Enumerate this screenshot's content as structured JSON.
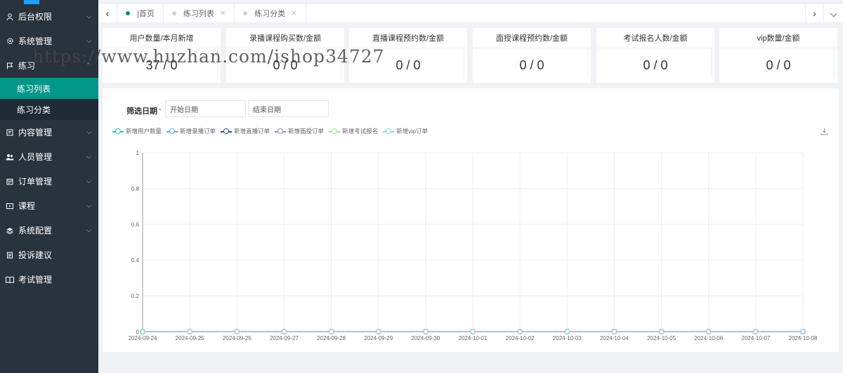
{
  "sidebar": {
    "items": [
      {
        "label": "后台权限",
        "icon": "user-icon",
        "arrow": "down"
      },
      {
        "label": "系统管理",
        "icon": "gear-icon",
        "arrow": "down"
      },
      {
        "label": "练习",
        "icon": "flag-icon",
        "arrow": "up"
      },
      {
        "label": "内容管理",
        "icon": "doc-icon",
        "arrow": "down"
      },
      {
        "label": "人员管理",
        "icon": "users-icon",
        "arrow": "down"
      },
      {
        "label": "订单管理",
        "icon": "calendar-icon",
        "arrow": "down"
      },
      {
        "label": "课程",
        "icon": "play-icon",
        "arrow": "down"
      },
      {
        "label": "系统配置",
        "icon": "layers-icon",
        "arrow": "down"
      },
      {
        "label": "投诉建议",
        "icon": "note-icon",
        "arrow": ""
      },
      {
        "label": "考试管理",
        "icon": "book-icon",
        "arrow": ""
      }
    ],
    "sub_items": [
      {
        "label": "练习列表",
        "active": true
      },
      {
        "label": "练习分类",
        "active": false
      }
    ]
  },
  "tabs": [
    {
      "label": "|首页",
      "closable": false
    },
    {
      "label": "练习列表",
      "closable": true
    },
    {
      "label": "练习分类",
      "closable": true
    }
  ],
  "stats": [
    {
      "title": "用户数量/本月新增",
      "value": "37 / 0"
    },
    {
      "title": "录播课程购买数/金额",
      "value": "0 / 0"
    },
    {
      "title": "直播课程预约数/金额",
      "value": "0 / 0"
    },
    {
      "title": "面授课程预约数/金额",
      "value": "0 / 0"
    },
    {
      "title": "考试报名人数/金额",
      "value": "0 / 0"
    },
    {
      "title": "vip数量/金额",
      "value": "0 / 0"
    }
  ],
  "watermark": "https://www.huzhan.com/ishop34727",
  "filter": {
    "label": "筛选日期",
    "dash": "-",
    "start_placeholder": "开始日期",
    "end_placeholder": "结束日期"
  },
  "colors": {
    "accent": "#009688",
    "sidebar_bg": "#28333e"
  },
  "chart_data": {
    "type": "line",
    "x": [
      "2024-09-24",
      "2024-09-25",
      "2024-09-26",
      "2024-09-27",
      "2024-09-28",
      "2024-09-29",
      "2024-09-30",
      "2024-10-01",
      "2024-10-02",
      "2024-10-03",
      "2024-10-04",
      "2024-10-05",
      "2024-10-06",
      "2024-10-07",
      "2024-10-08"
    ],
    "yticks": [
      "0",
      "0.2",
      "0.4",
      "0.6",
      "0.8",
      "1"
    ],
    "ylim": [
      0,
      1
    ],
    "grid": true,
    "legend_position": "top-left",
    "series": [
      {
        "name": "新增用户数量",
        "color": "#2ec7c9",
        "values": [
          0,
          0,
          0,
          0,
          0,
          0,
          0,
          0,
          0,
          0,
          0,
          0,
          0,
          0,
          0
        ]
      },
      {
        "name": "新增录播订单",
        "color": "#5ab1ef",
        "values": [
          0,
          0,
          0,
          0,
          0,
          0,
          0,
          0,
          0,
          0,
          0,
          0,
          0,
          0,
          0
        ]
      },
      {
        "name": "新增直播订单",
        "color": "#3a4fa0",
        "values": [
          0,
          0,
          0,
          0,
          0,
          0,
          0,
          0,
          0,
          0,
          0,
          0,
          0,
          0,
          0
        ]
      },
      {
        "name": "新增面授订单",
        "color": "#8d98b3",
        "values": [
          0,
          0,
          0,
          0,
          0,
          0,
          0,
          0,
          0,
          0,
          0,
          0,
          0,
          0,
          0
        ]
      },
      {
        "name": "新增考试报名",
        "color": "#a8e0a0",
        "values": [
          0,
          0,
          0,
          0,
          0,
          0,
          0,
          0,
          0,
          0,
          0,
          0,
          0,
          0,
          0
        ]
      },
      {
        "name": "新增vip订单",
        "color": "#8ad6dc",
        "values": [
          0,
          0,
          0,
          0,
          0,
          0,
          0,
          0,
          0,
          0,
          0,
          0,
          0,
          0,
          0
        ]
      }
    ]
  }
}
